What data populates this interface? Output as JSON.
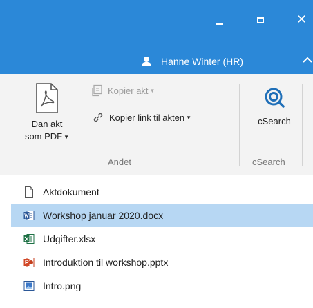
{
  "window": {
    "minimize_icon": "minimize-icon",
    "maximize_icon": "maximize-icon",
    "close_glyph": "✕"
  },
  "user": {
    "name": "Hanne Winter (HR)"
  },
  "ribbon": {
    "pdf_button": {
      "line1": "Dan akt",
      "line2": "som PDF"
    },
    "copy_akt": "Kopier akt",
    "copy_link": "Kopier link til akten",
    "csearch_button": "cSearch",
    "group_andet": "Andet",
    "group_csearch": "cSearch"
  },
  "files": [
    {
      "name": "Aktdokument",
      "icon": "document-icon"
    },
    {
      "name": "Workshop januar 2020.docx",
      "icon": "word-icon",
      "selected": true
    },
    {
      "name": "Udgifter.xlsx",
      "icon": "excel-icon"
    },
    {
      "name": "Introduktion til workshop.pptx",
      "icon": "powerpoint-icon"
    },
    {
      "name": "Intro.png",
      "icon": "image-icon"
    }
  ],
  "colors": {
    "titlebar": "#2b88d8",
    "selection": "#b7d7f3",
    "ribbon": "#f3f3f3"
  }
}
